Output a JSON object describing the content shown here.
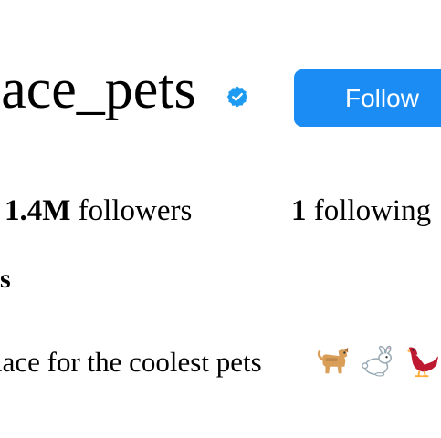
{
  "profile": {
    "username": "lace_pets",
    "verified": true,
    "follow_label": "Follow",
    "stats": {
      "followers_count": "1.4M",
      "followers_label": "followers",
      "following_count": "1",
      "following_label": "following"
    },
    "bio_name": "ts",
    "bio": "lace for the coolest pets",
    "bio_emoji": [
      "dog-emoji",
      "rabbit-emoji",
      "bird-emoji"
    ]
  },
  "colors": {
    "accent": "#1a8cf3",
    "verified_badge": "#1d9bf0",
    "text": "#000000",
    "background": "#ffffff"
  }
}
